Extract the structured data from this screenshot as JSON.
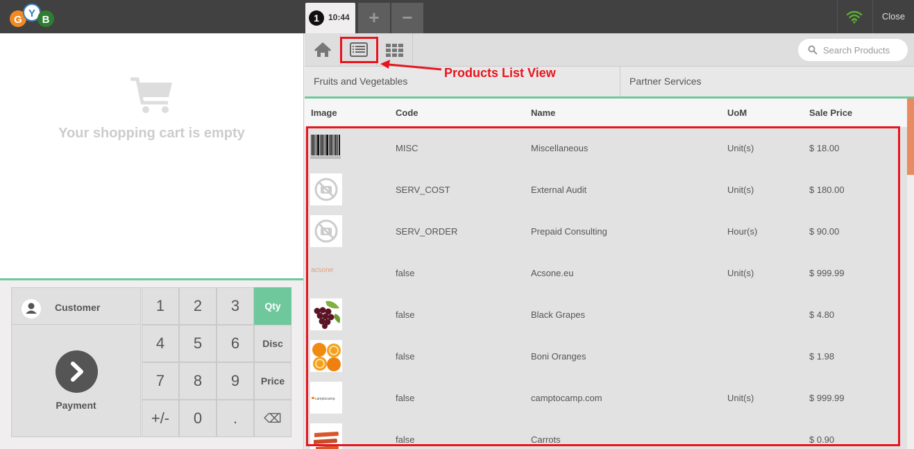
{
  "header": {
    "logo_letters": [
      "G",
      "Y",
      "B"
    ],
    "order_number": "1",
    "order_time": "10:44",
    "add_order_label": "+",
    "remove_order_label": "−",
    "connection_icon": "wifi-icon",
    "close_label": "Close"
  },
  "cart": {
    "empty_message": "Your shopping cart is empty",
    "icon": "cart-icon"
  },
  "actionpad": {
    "customer_label": "Customer",
    "payment_label": "Payment"
  },
  "numpad": {
    "keys": [
      [
        "1",
        "2",
        "3",
        "Qty"
      ],
      [
        "4",
        "5",
        "6",
        "Disc"
      ],
      [
        "7",
        "8",
        "9",
        "Price"
      ],
      [
        "+/-",
        "0",
        ".",
        "⌫"
      ]
    ],
    "active_mode": "Qty"
  },
  "toolbar": {
    "home_icon": "home-icon",
    "list_view_icon": "list-view-icon",
    "grid_view_icon": "grid-view-icon",
    "search_placeholder": "Search Products"
  },
  "categories": [
    "Fruits and Vegetables",
    "Partner Services"
  ],
  "products": {
    "columns": [
      "Image",
      "Code",
      "Name",
      "UoM",
      "Sale Price"
    ],
    "rows": [
      {
        "image": "barcode",
        "code": "MISC",
        "name": "Miscellaneous",
        "uom": "Unit(s)",
        "price": "$ 18.00"
      },
      {
        "image": "no-image",
        "code": "SERV_COST",
        "name": "External Audit",
        "uom": "Unit(s)",
        "price": "$ 180.00"
      },
      {
        "image": "no-image",
        "code": "SERV_ORDER",
        "name": "Prepaid Consulting",
        "uom": "Hour(s)",
        "price": "$ 90.00"
      },
      {
        "image": "acsone-logo",
        "image_text": "acsone",
        "code": "false",
        "name": "Acsone.eu",
        "uom": "Unit(s)",
        "price": "$ 999.99"
      },
      {
        "image": "grapes",
        "code": "false",
        "name": "Black Grapes",
        "uom": "",
        "price": "$ 4.80"
      },
      {
        "image": "oranges",
        "code": "false",
        "name": "Boni Oranges",
        "uom": "",
        "price": "$ 1.98"
      },
      {
        "image": "camptocamp-logo",
        "image_text": "camptocamp",
        "code": "false",
        "name": "camptocamp.com",
        "uom": "Unit(s)",
        "price": "$ 999.99"
      },
      {
        "image": "carrots",
        "code": "false",
        "name": "Carrots",
        "uom": "",
        "price": "$ 0.90"
      }
    ]
  },
  "annotation": {
    "label": "Products List View",
    "color": "#e8141e"
  },
  "colors": {
    "accent": "#6ec89b",
    "header": "#414141",
    "scroll_thumb": "#e88b62"
  }
}
